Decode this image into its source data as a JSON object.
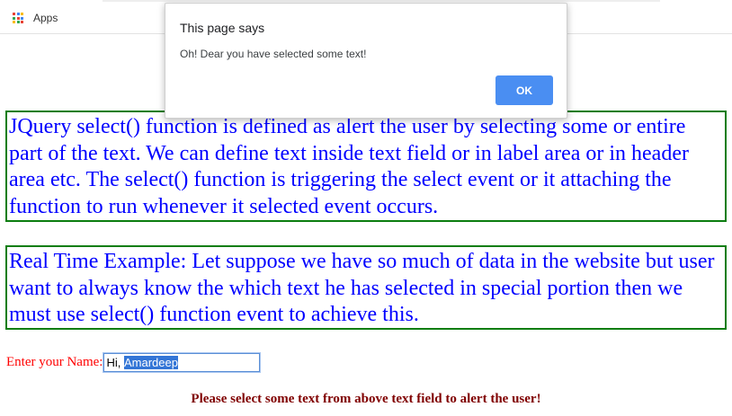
{
  "browser": {
    "bookmarks_bar": {
      "apps_label": "Apps",
      "apps_icon_colors": [
        "#ea4335",
        "#4285f4",
        "#fbbc05",
        "#34a853",
        "#ea4335",
        "#4285f4",
        "#fbbc05",
        "#34a853",
        "#ea4335"
      ]
    }
  },
  "dialog": {
    "title": "This page says",
    "message": "Oh! Dear you have selected some text!",
    "ok_label": "OK"
  },
  "content": {
    "paragraph_1": "JQuery select() function is defined as alert the user by selecting some or entire part of the text. We can define text inside text field or in label area or in header area etc. The select() function is triggering the select event or it attaching the function to run whenever it selected event occurs.",
    "paragraph_2": "Real Time Example: Let suppose we have so much of data in the website but user want to always know the which text he has selected in special portion then we must use select() function event to achieve this.",
    "name_label": "Enter your Name:",
    "name_input_prefix": "Hi, ",
    "name_input_selected": "Amardeep",
    "instruction": "Please select some text from above text field to alert the user!"
  },
  "colors": {
    "paragraph_text": "#0000ff",
    "box_border": "#0b7d10",
    "label_text": "#ff0000",
    "instruction_text": "#800000",
    "ok_button": "#4a8ef2",
    "selection": "#3375d6"
  }
}
